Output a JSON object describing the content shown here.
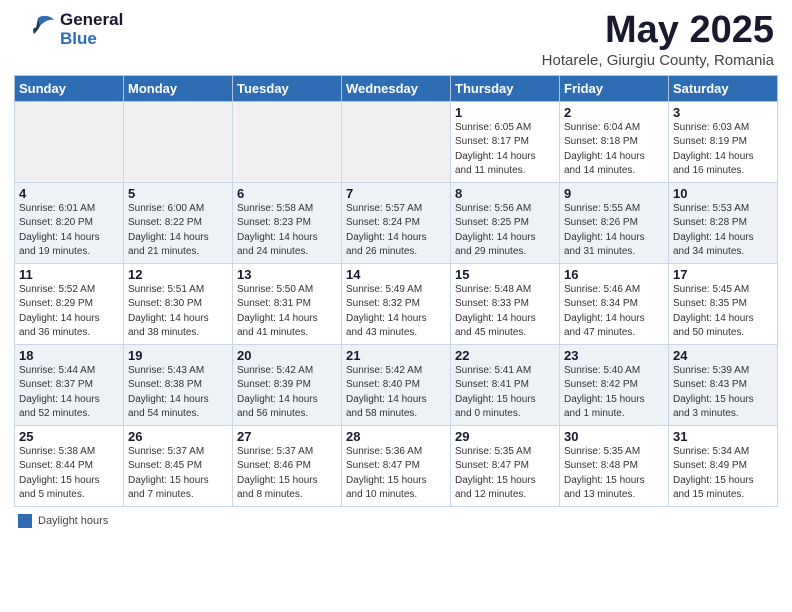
{
  "header": {
    "logo_general": "General",
    "logo_blue": "Blue",
    "month_title": "May 2025",
    "location": "Hotarele, Giurgiu County, Romania"
  },
  "days_of_week": [
    "Sunday",
    "Monday",
    "Tuesday",
    "Wednesday",
    "Thursday",
    "Friday",
    "Saturday"
  ],
  "weeks": [
    [
      {
        "day": "",
        "info": ""
      },
      {
        "day": "",
        "info": ""
      },
      {
        "day": "",
        "info": ""
      },
      {
        "day": "",
        "info": ""
      },
      {
        "day": "1",
        "info": "Sunrise: 6:05 AM\nSunset: 8:17 PM\nDaylight: 14 hours\nand 11 minutes."
      },
      {
        "day": "2",
        "info": "Sunrise: 6:04 AM\nSunset: 8:18 PM\nDaylight: 14 hours\nand 14 minutes."
      },
      {
        "day": "3",
        "info": "Sunrise: 6:03 AM\nSunset: 8:19 PM\nDaylight: 14 hours\nand 16 minutes."
      }
    ],
    [
      {
        "day": "4",
        "info": "Sunrise: 6:01 AM\nSunset: 8:20 PM\nDaylight: 14 hours\nand 19 minutes."
      },
      {
        "day": "5",
        "info": "Sunrise: 6:00 AM\nSunset: 8:22 PM\nDaylight: 14 hours\nand 21 minutes."
      },
      {
        "day": "6",
        "info": "Sunrise: 5:58 AM\nSunset: 8:23 PM\nDaylight: 14 hours\nand 24 minutes."
      },
      {
        "day": "7",
        "info": "Sunrise: 5:57 AM\nSunset: 8:24 PM\nDaylight: 14 hours\nand 26 minutes."
      },
      {
        "day": "8",
        "info": "Sunrise: 5:56 AM\nSunset: 8:25 PM\nDaylight: 14 hours\nand 29 minutes."
      },
      {
        "day": "9",
        "info": "Sunrise: 5:55 AM\nSunset: 8:26 PM\nDaylight: 14 hours\nand 31 minutes."
      },
      {
        "day": "10",
        "info": "Sunrise: 5:53 AM\nSunset: 8:28 PM\nDaylight: 14 hours\nand 34 minutes."
      }
    ],
    [
      {
        "day": "11",
        "info": "Sunrise: 5:52 AM\nSunset: 8:29 PM\nDaylight: 14 hours\nand 36 minutes."
      },
      {
        "day": "12",
        "info": "Sunrise: 5:51 AM\nSunset: 8:30 PM\nDaylight: 14 hours\nand 38 minutes."
      },
      {
        "day": "13",
        "info": "Sunrise: 5:50 AM\nSunset: 8:31 PM\nDaylight: 14 hours\nand 41 minutes."
      },
      {
        "day": "14",
        "info": "Sunrise: 5:49 AM\nSunset: 8:32 PM\nDaylight: 14 hours\nand 43 minutes."
      },
      {
        "day": "15",
        "info": "Sunrise: 5:48 AM\nSunset: 8:33 PM\nDaylight: 14 hours\nand 45 minutes."
      },
      {
        "day": "16",
        "info": "Sunrise: 5:46 AM\nSunset: 8:34 PM\nDaylight: 14 hours\nand 47 minutes."
      },
      {
        "day": "17",
        "info": "Sunrise: 5:45 AM\nSunset: 8:35 PM\nDaylight: 14 hours\nand 50 minutes."
      }
    ],
    [
      {
        "day": "18",
        "info": "Sunrise: 5:44 AM\nSunset: 8:37 PM\nDaylight: 14 hours\nand 52 minutes."
      },
      {
        "day": "19",
        "info": "Sunrise: 5:43 AM\nSunset: 8:38 PM\nDaylight: 14 hours\nand 54 minutes."
      },
      {
        "day": "20",
        "info": "Sunrise: 5:42 AM\nSunset: 8:39 PM\nDaylight: 14 hours\nand 56 minutes."
      },
      {
        "day": "21",
        "info": "Sunrise: 5:42 AM\nSunset: 8:40 PM\nDaylight: 14 hours\nand 58 minutes."
      },
      {
        "day": "22",
        "info": "Sunrise: 5:41 AM\nSunset: 8:41 PM\nDaylight: 15 hours\nand 0 minutes."
      },
      {
        "day": "23",
        "info": "Sunrise: 5:40 AM\nSunset: 8:42 PM\nDaylight: 15 hours\nand 1 minute."
      },
      {
        "day": "24",
        "info": "Sunrise: 5:39 AM\nSunset: 8:43 PM\nDaylight: 15 hours\nand 3 minutes."
      }
    ],
    [
      {
        "day": "25",
        "info": "Sunrise: 5:38 AM\nSunset: 8:44 PM\nDaylight: 15 hours\nand 5 minutes."
      },
      {
        "day": "26",
        "info": "Sunrise: 5:37 AM\nSunset: 8:45 PM\nDaylight: 15 hours\nand 7 minutes."
      },
      {
        "day": "27",
        "info": "Sunrise: 5:37 AM\nSunset: 8:46 PM\nDaylight: 15 hours\nand 8 minutes."
      },
      {
        "day": "28",
        "info": "Sunrise: 5:36 AM\nSunset: 8:47 PM\nDaylight: 15 hours\nand 10 minutes."
      },
      {
        "day": "29",
        "info": "Sunrise: 5:35 AM\nSunset: 8:47 PM\nDaylight: 15 hours\nand 12 minutes."
      },
      {
        "day": "30",
        "info": "Sunrise: 5:35 AM\nSunset: 8:48 PM\nDaylight: 15 hours\nand 13 minutes."
      },
      {
        "day": "31",
        "info": "Sunrise: 5:34 AM\nSunset: 8:49 PM\nDaylight: 15 hours\nand 15 minutes."
      }
    ]
  ],
  "footer": {
    "daylight_label": "Daylight hours"
  }
}
